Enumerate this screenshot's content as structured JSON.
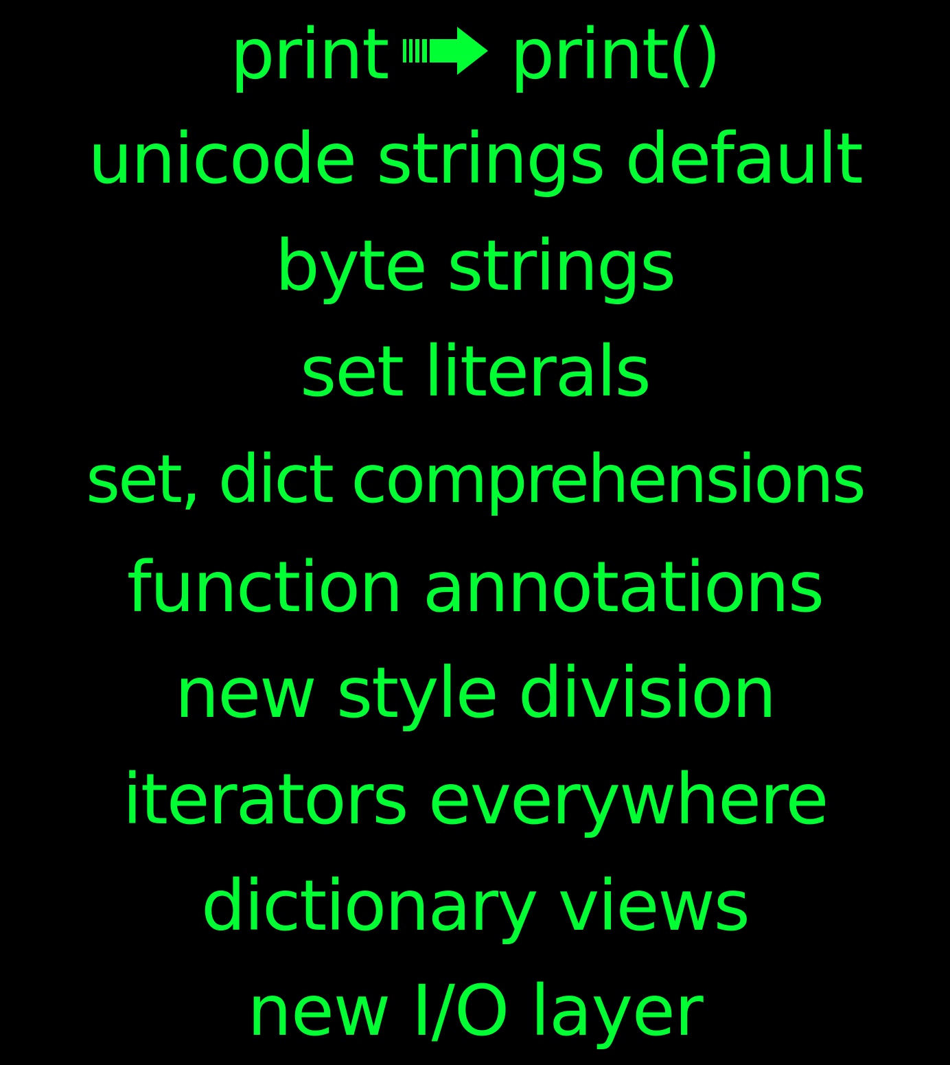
{
  "lines": {
    "print_before": "print",
    "print_arrow_icon": "arrow-right-icon",
    "print_after": "print()",
    "unicode": "unicode strings default",
    "byte": "byte strings",
    "set_literals": "set literals",
    "comprehensions": "set, dict comprehensions",
    "annotations": "function annotations",
    "division": "new style division",
    "iterators": "iterators everywhere",
    "dict_views": "dictionary views",
    "io_layer": "new I/O layer"
  },
  "colors": {
    "background": "#000000",
    "text": "#00ff33"
  }
}
